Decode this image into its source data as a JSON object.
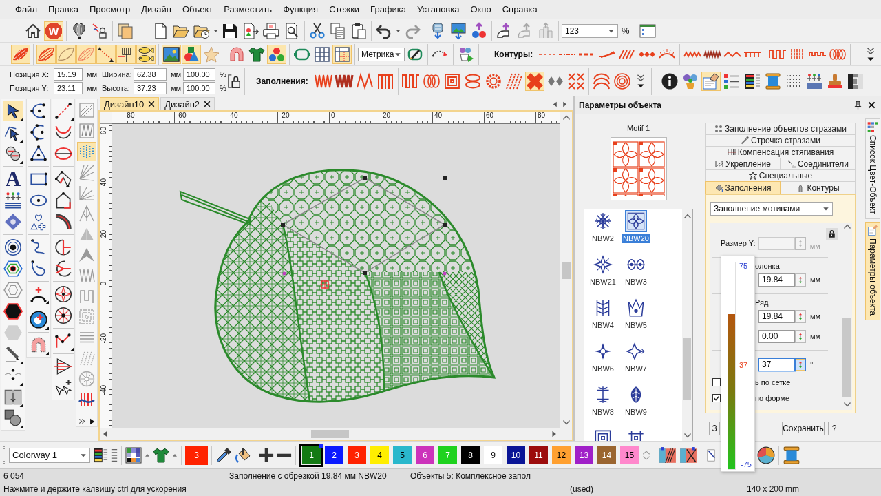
{
  "menu": [
    "Файл",
    "Правка",
    "Просмотр",
    "Дизайн",
    "Объект",
    "Разместить",
    "Функция",
    "Стежки",
    "Графика",
    "Установка",
    "Окно",
    "Справка"
  ],
  "toolbar_top": [
    {
      "selected": false
    },
    {
      "selected": true,
      "glyph": "w"
    },
    {
      "selected": false
    },
    {
      "selected": false
    },
    {
      "selected": false
    },
    {
      "selected": false
    },
    {
      "selected": false
    },
    {
      "selected": false
    },
    {
      "selected": false
    },
    {
      "selected": false
    },
    {
      "selected": false
    },
    {
      "selected": false
    },
    {
      "selected": false
    },
    {
      "selected": false
    },
    {
      "selected": false
    },
    {
      "selected": false
    },
    {
      "selected": false
    },
    {
      "selected": false
    },
    {
      "selected": false
    },
    {
      "selected": false
    },
    {
      "selected": false
    },
    {
      "selected": false
    },
    {
      "selected": false
    },
    {
      "selected": false
    }
  ],
  "zoom": {
    "value": "123",
    "unit": "%"
  },
  "toolbar_main": [
    {
      "selected": true
    },
    {
      "selected": true
    },
    {
      "selected": true
    },
    {
      "selected": true
    },
    {
      "selected": true
    },
    {
      "selected": true
    },
    {
      "selected": true
    },
    {
      "selected": true
    },
    {
      "selected": true
    },
    {
      "selected": false
    },
    {
      "selected": false
    },
    {
      "selected": false
    },
    {
      "selected": true
    },
    {
      "selected": false
    },
    {
      "selected": false
    },
    {
      "selected": true
    },
    {
      "selected": false
    },
    {
      "selected": false
    },
    {
      "selected": false
    },
    {
      "selected": false
    },
    {
      "selected": false
    },
    {
      "selected": false
    },
    {
      "selected": false
    },
    {
      "selected": false
    },
    {
      "selected": false
    },
    {
      "selected": false
    },
    {
      "selected": false
    },
    {
      "selected": false
    },
    {
      "selected": false
    },
    {
      "selected": false
    },
    {
      "selected": false
    },
    {
      "selected": false
    },
    {
      "selected": false
    },
    {
      "selected": false
    }
  ],
  "units": "Метрика",
  "contours_label": "Контуры:",
  "transform": {
    "pos_x": {
      "label": "Позиция X:",
      "value": "15.19",
      "unit": "мм"
    },
    "pos_y": {
      "label": "Позиция Y:",
      "value": "23.11",
      "unit": "мм"
    },
    "width": {
      "label": "Ширина:",
      "value": "62.38",
      "unit": "мм",
      "percent": "100.00",
      "percent_unit": "%"
    },
    "height": {
      "label": "Высота:",
      "value": "37.23",
      "unit": "мм",
      "percent": "100.00",
      "percent_unit": "%"
    }
  },
  "fills_label": "Заполнения:",
  "toolbar_fills": [
    {
      "selected": false
    },
    {
      "selected": false
    },
    {
      "selected": false
    },
    {
      "selected": false
    },
    {
      "selected": false
    },
    {
      "selected": false
    },
    {
      "selected": false
    },
    {
      "selected": false
    },
    {
      "selected": false
    },
    {
      "selected": false
    },
    {
      "selected": true
    },
    {
      "selected": false
    },
    {
      "selected": false
    },
    {
      "selected": false
    },
    {
      "selected": false
    },
    {
      "selected": false
    },
    {
      "selected": false
    },
    {
      "selected": true
    },
    {
      "selected": false
    },
    {
      "selected": false
    },
    {
      "selected": false
    },
    {
      "selected": false
    },
    {
      "selected": false
    },
    {
      "selected": false
    },
    {
      "selected": false
    }
  ],
  "tool_columns": [
    {
      "tools": [
        {
          "selected": true
        },
        {
          "selected": false
        },
        {
          "selected": false
        },
        {
          "selected": false,
          "glyph": "A"
        },
        {
          "selected": false
        },
        {
          "selected": false
        },
        {
          "selected": false
        },
        {
          "selected": false
        },
        {
          "selected": false
        },
        {
          "selected": false
        },
        {
          "selected": false
        },
        {
          "selected": false
        },
        {
          "selected": false
        },
        {
          "selected": false
        },
        {
          "selected": false
        }
      ]
    },
    {
      "tools": [
        {
          "selected": false
        },
        {
          "selected": false
        },
        {
          "selected": false
        },
        {
          "selected": false
        },
        {
          "selected": false
        },
        {
          "selected": false
        },
        {
          "selected": false
        },
        {
          "selected": false
        },
        {
          "selected": false
        },
        {
          "selected": false
        },
        {
          "selected": false
        }
      ]
    },
    {
      "tools": [
        {
          "selected": false
        },
        {
          "selected": false
        },
        {
          "selected": false
        },
        {
          "selected": false
        },
        {
          "selected": false
        },
        {
          "selected": false
        },
        {
          "selected": false
        },
        {
          "selected": false
        },
        {
          "selected": false
        },
        {
          "selected": false
        },
        {
          "selected": false
        },
        {
          "selected": false
        },
        {
          "selected": false
        }
      ]
    },
    {
      "tools": [
        {
          "selected": false
        },
        {
          "selected": false
        },
        {
          "selected": true
        },
        {
          "selected": false
        },
        {
          "selected": false
        },
        {
          "selected": false
        },
        {
          "selected": false
        },
        {
          "selected": false
        },
        {
          "selected": false
        },
        {
          "selected": false
        },
        {
          "selected": false
        },
        {
          "selected": false
        },
        {
          "selected": false
        },
        {
          "selected": false
        },
        {
          "selected": false
        }
      ]
    }
  ],
  "document_tabs": [
    {
      "label": "Дизайн10",
      "selected": true
    },
    {
      "label": "Дизайн2",
      "selected": false
    }
  ],
  "ruler": {
    "x_labels": [
      "-80",
      "-60",
      "-40",
      "-20",
      "0",
      "20",
      "40",
      "60",
      "80"
    ],
    "y_labels": [
      "60",
      "40",
      "20",
      "0",
      "-20",
      "-40"
    ]
  },
  "object_panel": {
    "title": "Параметры объекта",
    "motif_label": "Motif 1",
    "motifs": [
      {
        "label": "NBW2",
        "selected": false
      },
      {
        "label": "NBW20",
        "selected": true
      },
      {
        "label": "NBW21",
        "selected": false
      },
      {
        "label": "NBW3",
        "selected": false
      },
      {
        "label": "NBW4",
        "selected": false
      },
      {
        "label": "NBW5",
        "selected": false
      },
      {
        "label": "NBW6",
        "selected": false
      },
      {
        "label": "NBW7",
        "selected": false
      },
      {
        "label": "NBW8",
        "selected": false
      },
      {
        "label": "NBW9",
        "selected": false
      },
      {
        "selected": false
      },
      {
        "selected": false
      }
    ],
    "tab_rows": [
      {
        "tabs": [
          {
            "label": "Заполнение объектов стразами",
            "selected": false
          }
        ]
      },
      {
        "tabs": [
          {
            "label": "Строчка стразами",
            "selected": false
          }
        ]
      },
      {
        "tabs": [
          {
            "label": "Компенсация стягивания",
            "selected": false
          }
        ]
      },
      {
        "tabs": [
          {
            "label": "Укрепление",
            "selected": false
          },
          {
            "label": "Соединители",
            "selected": false
          }
        ]
      },
      {
        "tabs": [
          {
            "label": "Специальные",
            "selected": false
          }
        ]
      },
      {
        "tabs": [
          {
            "label": "Заполнения",
            "selected": true
          },
          {
            "label": "Контуры",
            "selected": false
          }
        ]
      }
    ],
    "fill_type": "Заполнение мотивами",
    "size_y": {
      "label": "Размер Y:",
      "unit": "мм",
      "disabled": true
    },
    "column": {
      "label": "олонка",
      "value": "19.84",
      "unit": "мм"
    },
    "row": {
      "label": "Ряд",
      "value": "19.84",
      "unit": "мм"
    },
    "offset": {
      "value": "0.00",
      "unit": "мм"
    },
    "angle": {
      "value": "37",
      "unit": "°",
      "focused": true
    },
    "checkboxes": [
      {
        "label": "ь по сетке",
        "checked": false
      },
      {
        "label": "по форме",
        "checked": true
      }
    ],
    "buttons": [
      "З",
      "Сохранить",
      "?"
    ]
  },
  "angle_slider": {
    "max_label": "75",
    "reading": "37",
    "min_label": "-75",
    "level": 0.75
  },
  "side_tabs": [
    {
      "label": "Список Цвет-Объект",
      "selected": false
    },
    {
      "label": "Параметры объекта",
      "selected": true
    }
  ],
  "palette": {
    "colorway": "Colorway 1",
    "current": {
      "label": "3",
      "color": "#ff2200"
    },
    "swatches": [
      {
        "label": "1",
        "color": "#137a13",
        "selected": true
      },
      {
        "label": "2",
        "color": "#0a1aff",
        "selected": false
      },
      {
        "label": "3",
        "color": "#ff2200",
        "selected": false
      },
      {
        "label": "4",
        "color": "#ffee00",
        "selected": false
      },
      {
        "label": "5",
        "color": "#2ab8cc",
        "selected": false
      },
      {
        "label": "6",
        "color": "#cc33bb",
        "selected": false
      },
      {
        "label": "7",
        "color": "#1ed21e",
        "selected": false
      },
      {
        "label": "8",
        "color": "#000000",
        "selected": false
      },
      {
        "label": "9",
        "color": "#ffffff",
        "selected": false
      },
      {
        "label": "10",
        "color": "#0a1596",
        "selected": false
      },
      {
        "label": "11",
        "color": "#9c0c0c",
        "selected": false
      },
      {
        "label": "12",
        "color": "#ffa030",
        "selected": false
      },
      {
        "label": "13",
        "color": "#a020c8",
        "selected": false
      },
      {
        "label": "14",
        "color": "#9a6530",
        "selected": false
      },
      {
        "label": "15",
        "color": "#ff88cc",
        "selected": false
      }
    ]
  },
  "status_bar": {
    "stitches": "6 054",
    "fill_info": "Заполнение с обрезкой 19.84 мм NBW20",
    "objects": "Объекты 5: Комплексное запол",
    "hint": "Нажмите и держите калвишу ctrl для ускорения",
    "used": "(used)",
    "hoop_size": "140 x 200 mm"
  }
}
